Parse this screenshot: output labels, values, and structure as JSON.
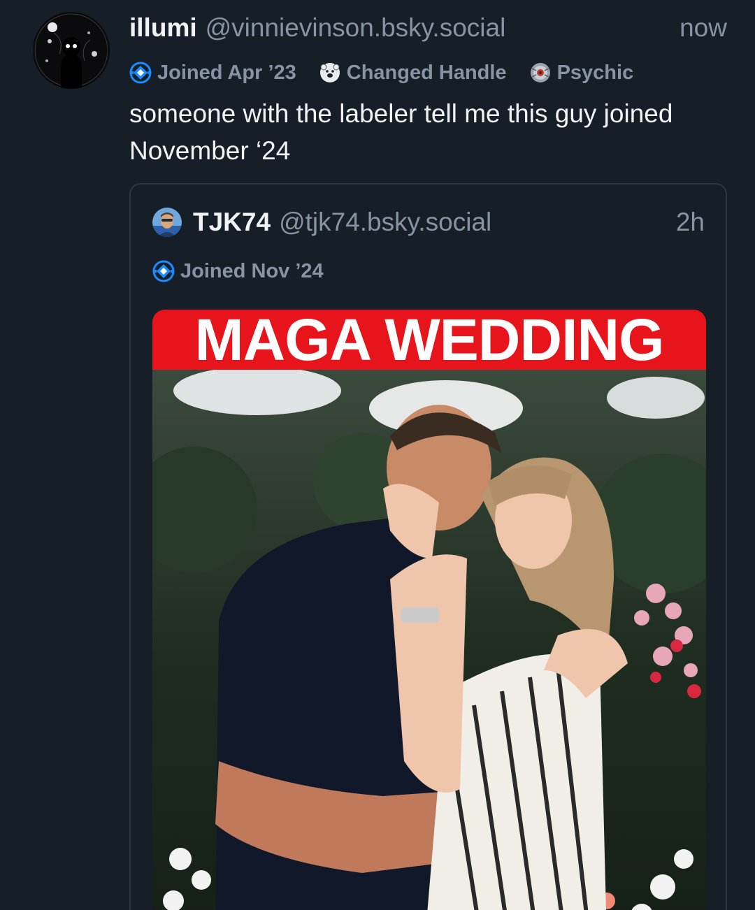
{
  "post": {
    "display_name": "illumi",
    "handle": "@vinnievinson.bsky.social",
    "timestamp": "now",
    "avatar_icon": "shadow-figure-avatar",
    "badges": [
      {
        "icon": "labeler-badge-icon",
        "label": "Joined Apr ’23"
      },
      {
        "icon": "polar-bear-badge-icon",
        "label": "Changed Handle"
      },
      {
        "icon": "psychic-badge-icon",
        "label": "Psychic"
      }
    ],
    "text": "someone with the labeler tell me this guy joined November ‘24"
  },
  "quote": {
    "display_name": "TJK74",
    "handle": "@tjk74.bsky.social",
    "timestamp": "2h",
    "avatar_icon": "user-photo-avatar",
    "badges": [
      {
        "icon": "labeler-badge-icon",
        "label": "Joined Nov ’24"
      }
    ],
    "image": {
      "banner_text": "MAGA WEDDING",
      "banner_color": "#e8141b",
      "description": "photo"
    }
  },
  "colors": {
    "background": "#161e27",
    "primary_text": "#f1f3f5",
    "secondary_text": "#8794a5",
    "border": "#2c3744",
    "badge_blue": "#1a8cff"
  }
}
